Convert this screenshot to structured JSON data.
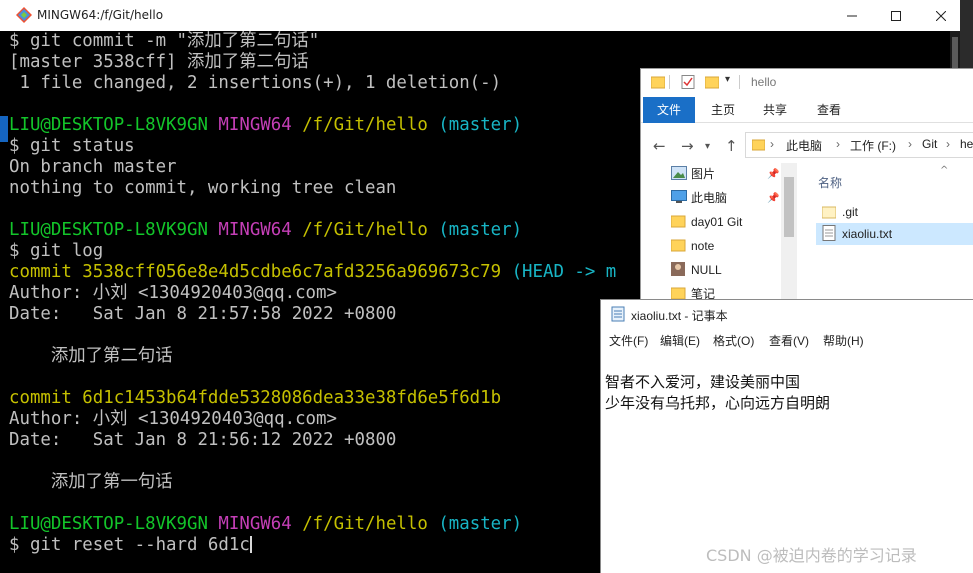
{
  "terminal": {
    "title": "MINGW64:/f/Git/hello",
    "lines": [
      [
        "$ git commit -m \"添加了第二句话\""
      ],
      [
        "[master 3538cff] 添加了第二句话"
      ],
      [
        " 1 file changed, 2 insertions(+), 1 deletion(-)"
      ],
      [
        ""
      ],
      [
        "LIU@DESKTOP-L8VK9GN",
        " ",
        "MINGW64",
        " ",
        "/f/Git/hello",
        " ",
        "(master)"
      ],
      [
        "$ git status"
      ],
      [
        "On branch master"
      ],
      [
        "nothing to commit, working tree clean"
      ],
      [
        ""
      ],
      [
        "LIU@DESKTOP-L8VK9GN",
        " ",
        "MINGW64",
        " ",
        "/f/Git/hello",
        " ",
        "(master)"
      ],
      [
        "$ git log"
      ],
      [
        "commit 3538cff056e8e4d5cdbe6c7afd3256a969673c79 ",
        "(HEAD -> m"
      ],
      [
        "Author: 小刘 <1304920403@qq.com>"
      ],
      [
        "Date:   Sat Jan 8 21:57:58 2022 +0800"
      ],
      [
        ""
      ],
      [
        "    添加了第二句话"
      ],
      [
        ""
      ],
      [
        "commit 6d1c1453b64fdde5328086dea33e38fd6e5f6d1b"
      ],
      [
        "Author: 小刘 <1304920403@qq.com>"
      ],
      [
        "Date:   Sat Jan 8 21:56:12 2022 +0800"
      ],
      [
        ""
      ],
      [
        "    添加了第一句话"
      ],
      [
        ""
      ],
      [
        "LIU@DESKTOP-L8VK9GN",
        " ",
        "MINGW64",
        " ",
        "/f/Git/hello",
        " ",
        "(master)"
      ],
      [
        "$ git reset --hard 6d1c"
      ]
    ],
    "colors": {
      "green": "#13c52a",
      "magenta": "#c53fb7",
      "yellow": "#c5c000",
      "cyan": "#18b5c5",
      "text": "#c0c0c0",
      "background": "#000000"
    }
  },
  "explorer": {
    "title": "hello",
    "ribbon_tabs": [
      "文件",
      "主页",
      "共享",
      "查看"
    ],
    "breadcrumbs": [
      "此电脑",
      "工作 (F:)",
      "Git",
      "he"
    ],
    "nav_items": [
      "图片",
      "此电脑",
      "day01 Git",
      "note",
      "NULL",
      "笔记"
    ],
    "column_header": "名称",
    "files": [
      ".git",
      "xiaoliu.txt"
    ],
    "selected_file": "xiaoliu.txt",
    "accent": "#1a6fc7"
  },
  "notepad": {
    "title": "xiaoliu.txt - 记事本",
    "menu": [
      "文件(F)",
      "编辑(E)",
      "格式(O)",
      "查看(V)",
      "帮助(H)"
    ],
    "content": [
      "智者不入爱河，建设美丽中国",
      "少年没有乌托邦，心向远方自明朗"
    ]
  },
  "watermark": "CSDN @被迫内卷的学习记录"
}
